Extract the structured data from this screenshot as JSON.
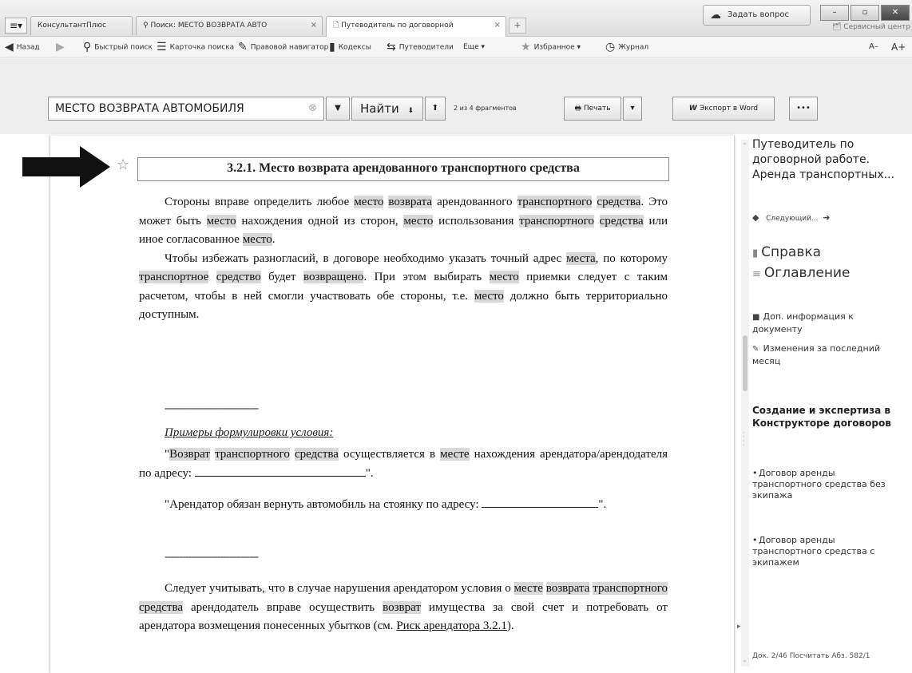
{
  "titlebar": {
    "tabs": [
      {
        "label": "КонсультантПлюс"
      },
      {
        "label": "Поиск: МЕСТО ВОЗВРАТА АВТО",
        "close": "×"
      },
      {
        "label": "Путеводитель по договорной",
        "close": "×"
      }
    ],
    "ask_label": "Задать вопрос",
    "service_center": "Сервисный центр",
    "menu_glyph": "≡▾",
    "add_tab_glyph": "+"
  },
  "toolbar": {
    "back": "Назад",
    "quick_search": "Быстрый поиск",
    "search_card": "Карточка поиска",
    "legal_navigator": "Правовой навигатор",
    "codes": "Кодексы",
    "guides": "Путеводители",
    "more": "Еще ▾",
    "favorites": "Избранное ▾",
    "journal": "Журнал",
    "font_minus": "А–",
    "font_plus": "А+"
  },
  "searchbar": {
    "query": "МЕСТО ВОЗВРАТА АВТОМОБИЛЯ",
    "find_label": "Найти",
    "fragment_count": "2 из 4 фрагментов",
    "print_label": "Печать",
    "export_label": "Экспорт в Word",
    "more_label": "•••"
  },
  "document": {
    "heading": "3.2.1. Место возврата арендованного транспортного средства",
    "examples_title": "Примеры формулировки условия:",
    "dashes": "--------------------------------",
    "para3_tail": "\".",
    "para4_tail": "\".",
    "risk_link": "Риск арендатора 3.2.1"
  },
  "rightpanel": {
    "title": "Путеводитель по договорной работе. Аренда транспортных...",
    "next_label": "Следующий...",
    "help": "Справка",
    "contents": "Оглавление",
    "extra_info": "Доп. информация к документу",
    "changes": "Изменения за последний месяц",
    "section_title": "Создание и экспертиза в Конструкторе договоров",
    "items": [
      "Договор аренды транспортного средства без экипажа",
      "Договор аренды транспортного средства с экипажем"
    ],
    "status": "Док. 2/46  Посчитать  Абз. 582/1"
  }
}
